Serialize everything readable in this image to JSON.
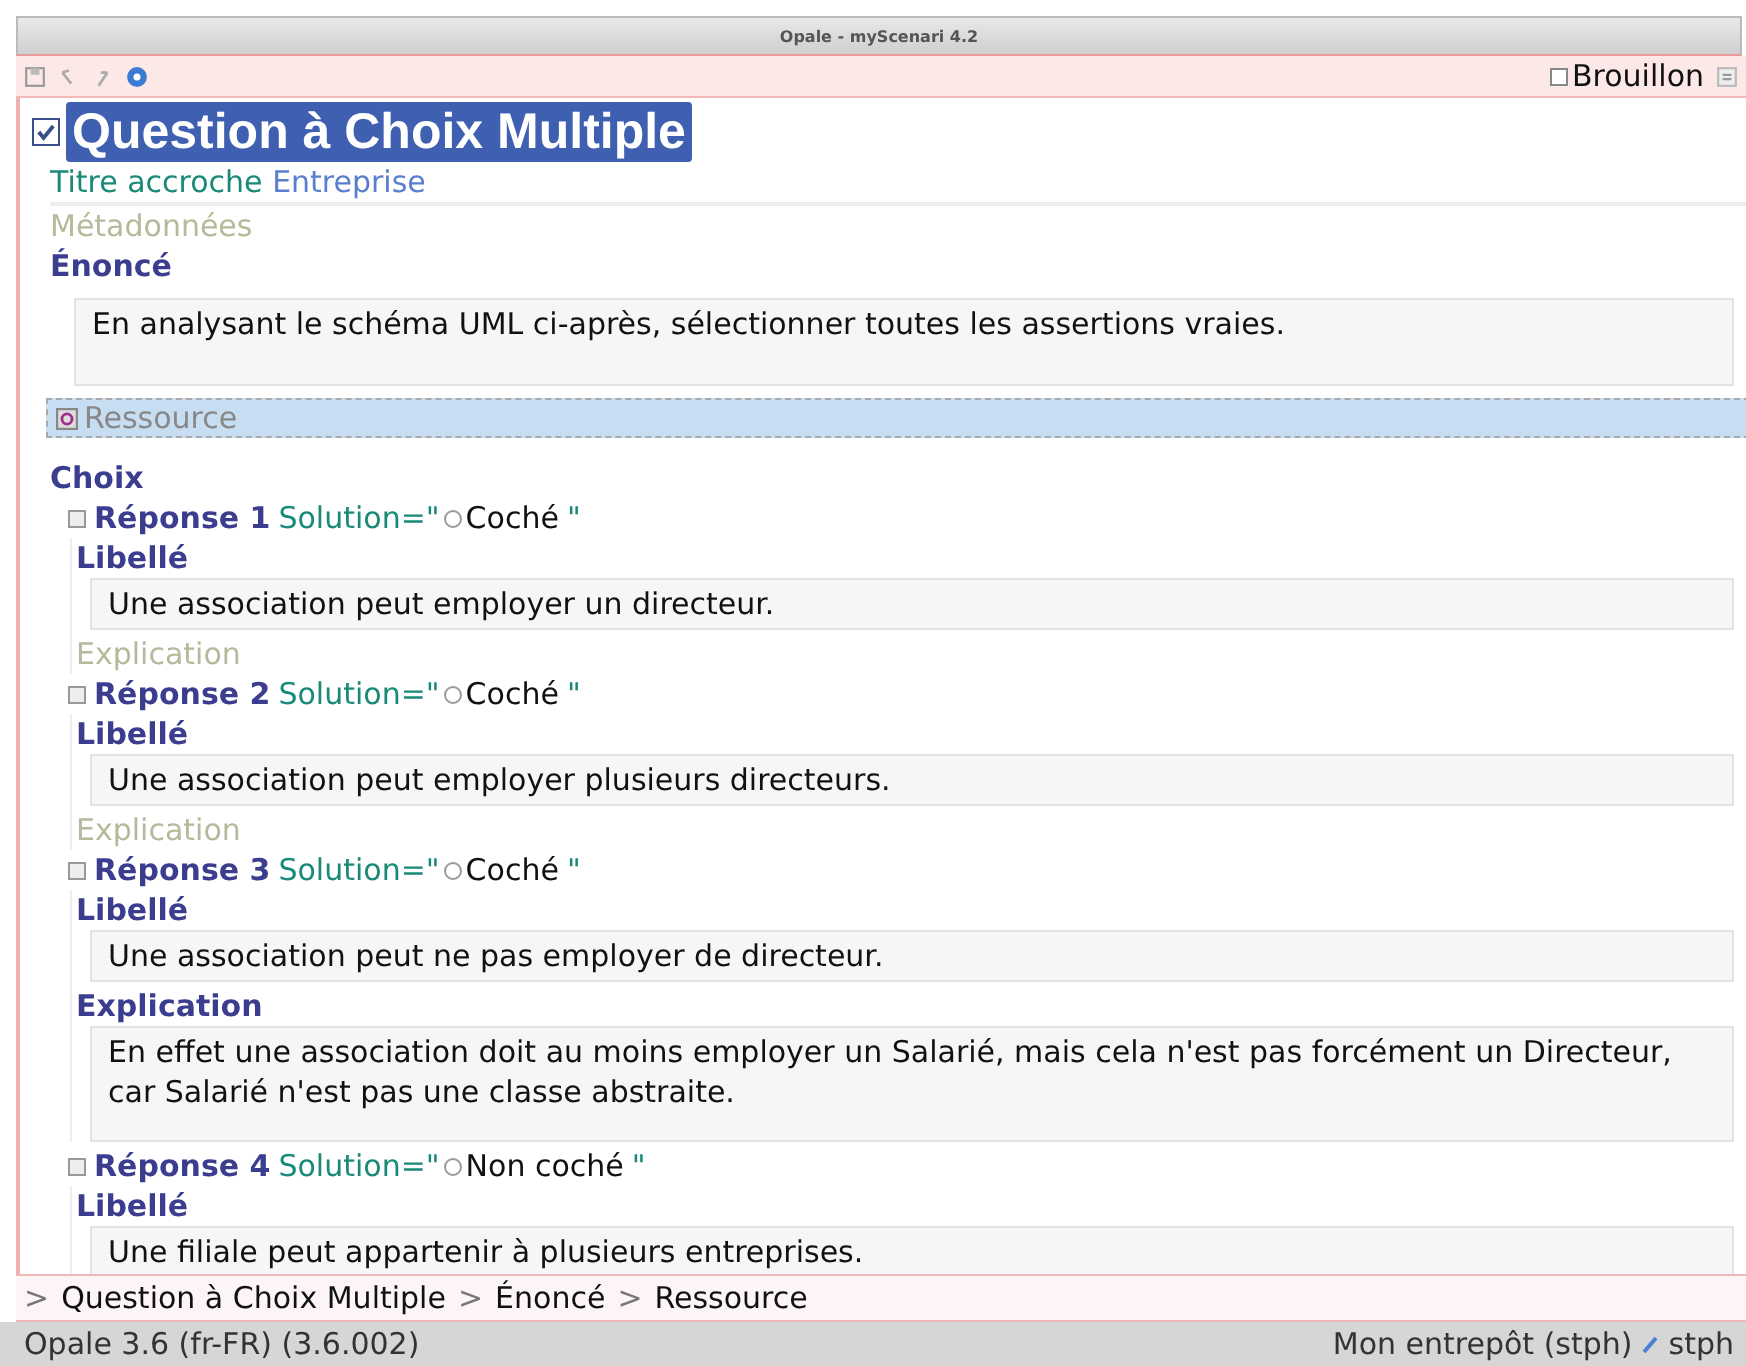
{
  "window": {
    "title": "Opale - myScenari 4.2"
  },
  "toolbar": {
    "draft": {
      "label": "Brouillon",
      "checked": false
    }
  },
  "document": {
    "title": "Question à Choix Multiple",
    "title_checked": true,
    "hook": {
      "label": "Titre accroche",
      "value": "Entreprise"
    },
    "metadata": {
      "label": "Métadonnées",
      "expanded": false
    },
    "statement": {
      "label": "Énoncé",
      "text": "En analysant le schéma UML ci-après, sélectionner toutes les assertions vraies.",
      "resource": {
        "label": "Ressource",
        "selected": true
      }
    },
    "choices": {
      "label": "Choix",
      "responses": [
        {
          "title": "Réponse 1",
          "solution_label": "Solution=\"",
          "solution": "Coché",
          "quote": "\"",
          "label_title": "Libellé",
          "label_text": "Une association peut employer un directeur.",
          "explanation": {
            "label": "Explication",
            "expanded": false
          }
        },
        {
          "title": "Réponse 2",
          "solution_label": "Solution=\"",
          "solution": "Coché",
          "quote": "\"",
          "label_title": "Libellé",
          "label_text": "Une association peut employer plusieurs directeurs.",
          "explanation": {
            "label": "Explication",
            "expanded": false
          }
        },
        {
          "title": "Réponse 3",
          "solution_label": "Solution=\"",
          "solution": "Coché",
          "quote": "\"",
          "label_title": "Libellé",
          "label_text": "Une association peut ne pas employer de directeur.",
          "explanation": {
            "label": "Explication",
            "expanded": true,
            "text": "En effet une association doit au moins employer un Salarié, mais cela n'est pas forcément un Directeur, car Salarié n'est pas une classe abstraite."
          }
        },
        {
          "title": "Réponse 4",
          "solution_label": "Solution=\"",
          "solution": "Non coché",
          "quote": "\"",
          "label_title": "Libellé",
          "label_text": "Une filiale peut appartenir à plusieurs entreprises."
        }
      ]
    }
  },
  "breadcrumb": [
    {
      "sep": ">",
      "label": "Question à Choix Multiple"
    },
    {
      "sep": ">",
      "label": "Énoncé"
    },
    {
      "sep": ">",
      "label": "Ressource"
    }
  ],
  "status_bar": {
    "left": "Opale 3.6 (fr-FR) (3.6.002)",
    "repo": "Mon entrepôt (stph)",
    "user": "stph"
  }
}
